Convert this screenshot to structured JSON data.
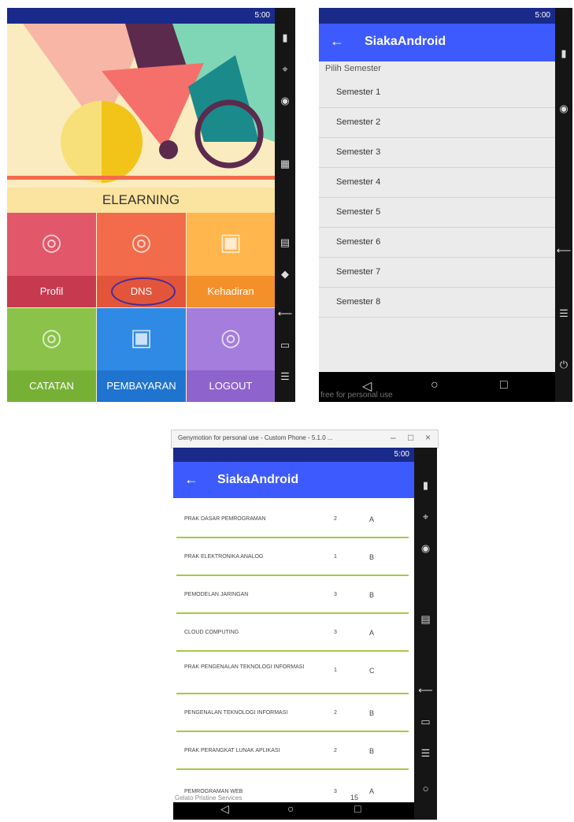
{
  "shared": {
    "status_time": "5:00",
    "app_title": "SiakaAndroid",
    "back_icon": "←"
  },
  "panel1": {
    "header_label": "ELEARNING",
    "tiles": [
      {
        "label": "Profil",
        "icon": "fingerprint-icon",
        "color": "#e25769",
        "label_color": "#c6394f"
      },
      {
        "label": "DNS",
        "icon": "fingerprint-icon",
        "color": "#f26b4a",
        "label_color": "#e2553a"
      },
      {
        "label": "Kehadiran",
        "icon": "presentation-icon",
        "color": "#ffb64c",
        "label_color": "#f4902a"
      },
      {
        "label": "CATATAN",
        "icon": "fingerprint-icon",
        "color": "#8bc34a",
        "label_color": "#76b035"
      },
      {
        "label": "PEMBAYARAN",
        "icon": "presentation-icon",
        "color": "#2f8ae6",
        "label_color": "#1f74cf"
      },
      {
        "label": "LOGOUT",
        "icon": "fingerprint-icon",
        "color": "#a57ddd",
        "label_color": "#8f63cc"
      }
    ]
  },
  "panel2": {
    "section_label": "Pilih Semester",
    "semesters": [
      "Semester 1",
      "Semester 2",
      "Semester 3",
      "Semester 4",
      "Semester 5",
      "Semester 6",
      "Semester 7",
      "Semester 8"
    ],
    "watermark": "free for personal use"
  },
  "panel3": {
    "window_title": "Genymotion for personal use - Custom Phone - 5.1.0 ...",
    "rows": [
      {
        "course": "PRAK DASAR PEMROGRAMAN",
        "sks": "2",
        "grade": "A"
      },
      {
        "course": "PRAK ELEKTRONIKA ANALOG",
        "sks": "1",
        "grade": "B"
      },
      {
        "course": "PEMODELAN JARINGAN",
        "sks": "3",
        "grade": "B"
      },
      {
        "course": "CLOUD COMPUTING",
        "sks": "3",
        "grade": "A"
      },
      {
        "course": "PRAK PENGENALAN TEKNOLOGI INFORMASI",
        "sks": "1",
        "grade": "C"
      },
      {
        "course": "PENGENALAN TEKNOLOGI INFORMASI",
        "sks": "2",
        "grade": "B"
      },
      {
        "course": "PRAK PERANGKAT LUNAK APLIKASI",
        "sks": "2",
        "grade": "B"
      },
      {
        "course": "PEMROGRAMAN WEB",
        "sks": "3",
        "grade": "A"
      }
    ],
    "total": "15",
    "watermark": "Gelato Pristine Services"
  }
}
